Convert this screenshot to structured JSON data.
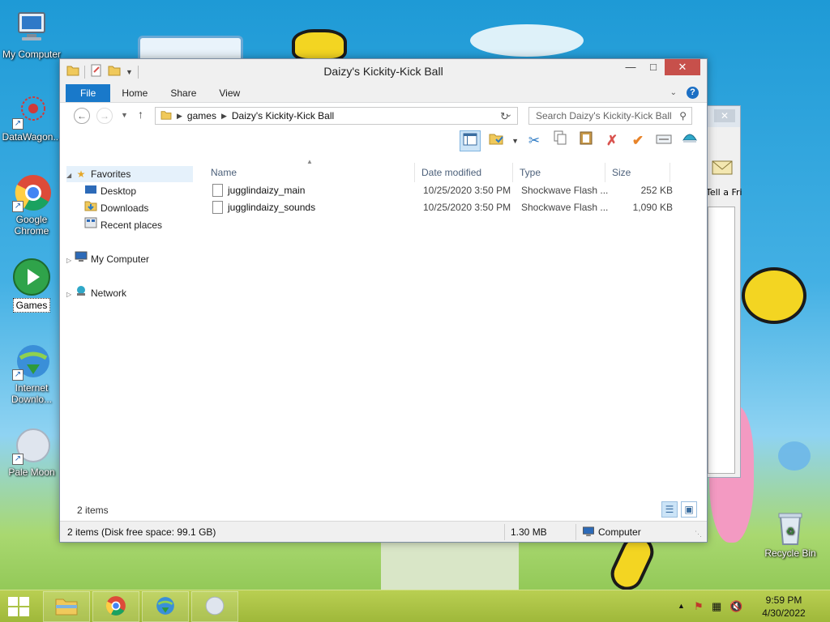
{
  "desktop": {
    "icons": [
      {
        "label": "My Computer"
      },
      {
        "label": "DataWagon..."
      },
      {
        "label": "Google Chrome"
      },
      {
        "label": "Games"
      },
      {
        "label": "Internet Downlo..."
      },
      {
        "label": "Pale Moon"
      },
      {
        "label": "Recycle Bin"
      }
    ],
    "background_window_label": "Tell a Fri"
  },
  "window": {
    "title": "Daizy's Kickity-Kick Ball",
    "ribbon_tabs": [
      "File",
      "Home",
      "Share",
      "View"
    ],
    "address": {
      "segments": [
        "games",
        "Daizy's Kickity-Kick Ball"
      ]
    },
    "search": {
      "placeholder": "Search Daizy's Kickity-Kick Ball"
    },
    "nav": {
      "favorites": "Favorites",
      "desktop": "Desktop",
      "downloads": "Downloads",
      "recent": "Recent places",
      "computer": "My Computer",
      "network": "Network"
    },
    "columns": {
      "name": "Name",
      "date": "Date modified",
      "type": "Type",
      "size": "Size"
    },
    "files": [
      {
        "name": "jugglindaizy_main",
        "date": "10/25/2020 3:50 PM",
        "type": "Shockwave Flash ...",
        "size": "252 KB"
      },
      {
        "name": "jugglindaizy_sounds",
        "date": "10/25/2020 3:50 PM",
        "type": "Shockwave Flash ...",
        "size": "1,090 KB"
      }
    ],
    "item_count": "2 items",
    "status": {
      "details": "2 items (Disk free space: 99.1 GB)",
      "size": "1.30 MB",
      "location": "Computer"
    }
  },
  "taskbar": {
    "clock_time": "9:59 PM",
    "clock_date": "4/30/2022"
  },
  "colors": {
    "file_tab": "#1979ca",
    "close_button": "#c7504b",
    "taskbar": "#a9c043"
  }
}
